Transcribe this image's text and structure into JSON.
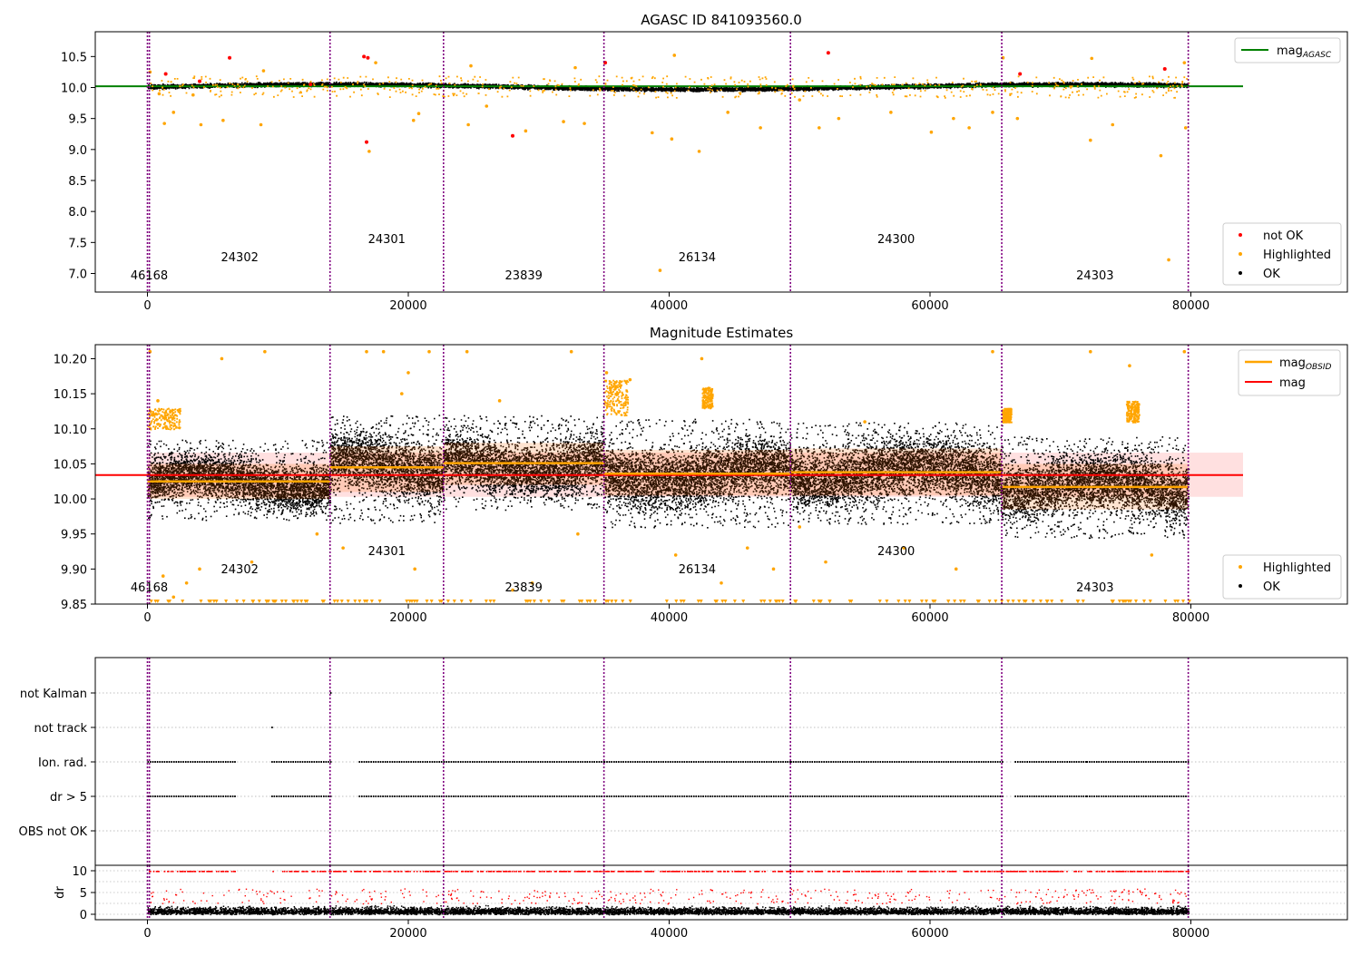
{
  "chart_data": [
    {
      "type": "scatter",
      "title": "AGASC ID 841093560.0",
      "xlabel": "",
      "ylabel": "",
      "xlim": [
        -4000,
        92000
      ],
      "ylim": [
        6.7,
        10.9
      ],
      "xticks": [
        0,
        20000,
        40000,
        60000,
        80000
      ],
      "xtick_labels": [
        "0",
        "20000",
        "40000",
        "60000",
        "80000"
      ],
      "yticks": [
        7.0,
        7.5,
        8.0,
        8.5,
        9.0,
        9.5,
        10.0,
        10.5
      ],
      "ytick_labels": [
        "7.0",
        "7.5",
        "8.0",
        "8.5",
        "9.0",
        "9.5",
        "10.0",
        "10.5"
      ],
      "reference_line": {
        "name": "mag",
        "name_sub": "AGASC",
        "value": 10.02,
        "color": "#008000"
      },
      "legend_top": "top-right",
      "legend_bottom": "bottom-right",
      "series": [
        {
          "name": "not OK",
          "color": "#ff0000",
          "points": [
            [
              1400,
              10.22
            ],
            [
              4000,
              10.1
            ],
            [
              6300,
              10.48
            ],
            [
              16600,
              10.5
            ],
            [
              16900,
              10.48
            ],
            [
              16800,
              9.12
            ],
            [
              28000,
              9.22
            ],
            [
              35100,
              10.4
            ],
            [
              52200,
              10.56
            ],
            [
              66900,
              10.22
            ],
            [
              78000,
              10.3
            ],
            [
              12500,
              10.05
            ]
          ]
        },
        {
          "name": "Highlighted",
          "color": "#ffa500",
          "points": [
            [
              200,
              10.25
            ],
            [
              900,
              9.9
            ],
            [
              1300,
              9.42
            ],
            [
              2000,
              9.6
            ],
            [
              3500,
              9.88
            ],
            [
              4100,
              9.4
            ],
            [
              5800,
              9.47
            ],
            [
              8700,
              9.4
            ],
            [
              8900,
              10.27
            ],
            [
              17000,
              8.97
            ],
            [
              17500,
              10.4
            ],
            [
              20400,
              9.47
            ],
            [
              20800,
              9.58
            ],
            [
              24800,
              10.35
            ],
            [
              24600,
              9.4
            ],
            [
              26000,
              9.7
            ],
            [
              29000,
              9.3
            ],
            [
              31900,
              9.45
            ],
            [
              32800,
              10.32
            ],
            [
              33500,
              9.42
            ],
            [
              38700,
              9.27
            ],
            [
              39300,
              7.05
            ],
            [
              40200,
              9.17
            ],
            [
              40400,
              10.52
            ],
            [
              42300,
              8.97
            ],
            [
              44500,
              9.6
            ],
            [
              47000,
              9.35
            ],
            [
              50000,
              9.8
            ],
            [
              51500,
              9.35
            ],
            [
              53000,
              9.5
            ],
            [
              57000,
              9.6
            ],
            [
              60100,
              9.28
            ],
            [
              61800,
              9.5
            ],
            [
              63000,
              9.35
            ],
            [
              64800,
              9.6
            ],
            [
              65600,
              10.48
            ],
            [
              66700,
              9.5
            ],
            [
              72300,
              9.15
            ],
            [
              72400,
              10.47
            ],
            [
              74000,
              9.4
            ],
            [
              77700,
              8.9
            ],
            [
              78300,
              7.22
            ],
            [
              79500,
              10.4
            ],
            [
              79600,
              9.35
            ]
          ]
        },
        {
          "name": "OK",
          "color": "#000000",
          "summary": "dense band near 10.0-10.1 across x = 0 to 80000"
        }
      ],
      "obsids": [
        {
          "label": "46168",
          "start": 0,
          "end": 150,
          "level": 0
        },
        {
          "label": "24302",
          "start": 150,
          "end": 14000,
          "level": 1
        },
        {
          "label": "24301",
          "start": 14000,
          "end": 22700,
          "level": 2
        },
        {
          "label": "23839",
          "start": 22700,
          "end": 35000,
          "level": 0
        },
        {
          "label": "26134",
          "start": 35000,
          "end": 49300,
          "level": 1
        },
        {
          "label": "24300",
          "start": 49300,
          "end": 65500,
          "level": 2
        },
        {
          "label": "24303",
          "start": 65500,
          "end": 79800,
          "level": 0
        }
      ]
    },
    {
      "type": "scatter",
      "title": "Magnitude Estimates",
      "xlabel": "",
      "ylabel": "",
      "xlim": [
        -4000,
        92000
      ],
      "ylim": [
        9.85,
        10.22
      ],
      "xticks": [
        0,
        20000,
        40000,
        60000,
        80000
      ],
      "xtick_labels": [
        "0",
        "20000",
        "40000",
        "60000",
        "80000"
      ],
      "yticks": [
        9.85,
        9.9,
        9.95,
        10.0,
        10.05,
        10.1,
        10.15,
        10.2
      ],
      "ytick_labels": [
        "9.85",
        "9.90",
        "9.95",
        "10.00",
        "10.05",
        "10.10",
        "10.15",
        "10.20"
      ],
      "mean_line": {
        "name": "mag",
        "value": 10.034,
        "band": [
          10.003,
          10.066
        ],
        "color": "#ff0000"
      },
      "obsid_mean_name": "mag",
      "obsid_mean_name_sub": "OBSID",
      "obsid_mean_color": "#ffa500",
      "obsid_means": [
        {
          "start": 0,
          "end": 14000,
          "mag": 10.025,
          "low": 10.0,
          "high": 10.05,
          "spread_low": 9.97,
          "spread_high": 10.085
        },
        {
          "start": 14000,
          "end": 22700,
          "mag": 10.045,
          "low": 10.01,
          "high": 10.075,
          "spread_low": 9.965,
          "spread_high": 10.12
        },
        {
          "start": 22700,
          "end": 35000,
          "mag": 10.051,
          "low": 10.02,
          "high": 10.08,
          "spread_low": 9.985,
          "spread_high": 10.12
        },
        {
          "start": 35000,
          "end": 49300,
          "mag": 10.036,
          "low": 10.005,
          "high": 10.07,
          "spread_low": 9.96,
          "spread_high": 10.115
        },
        {
          "start": 49300,
          "end": 65500,
          "mag": 10.038,
          "low": 10.005,
          "high": 10.072,
          "spread_low": 9.965,
          "spread_high": 10.11
        },
        {
          "start": 65500,
          "end": 79800,
          "mag": 10.017,
          "low": 9.985,
          "high": 10.05,
          "spread_low": 9.945,
          "spread_high": 10.09
        }
      ],
      "legend": "top-right",
      "legend_bottom": "bottom-right",
      "series": [
        {
          "name": "Highlighted",
          "color": "#ffa500",
          "points": [
            [
              200,
              10.21
            ],
            [
              500,
              10.12
            ],
            [
              800,
              10.14
            ],
            [
              1200,
              9.89
            ],
            [
              2000,
              9.86
            ],
            [
              3000,
              9.88
            ],
            [
              4000,
              9.9
            ],
            [
              5700,
              10.2
            ],
            [
              8000,
              9.91
            ],
            [
              9000,
              10.21
            ],
            [
              13000,
              9.95
            ],
            [
              15000,
              9.93
            ],
            [
              16800,
              10.21
            ],
            [
              18100,
              10.21
            ],
            [
              19500,
              10.15
            ],
            [
              20000,
              10.18
            ],
            [
              20500,
              9.9
            ],
            [
              21600,
              10.21
            ],
            [
              24500,
              10.21
            ],
            [
              27000,
              10.14
            ],
            [
              28000,
              9.87
            ],
            [
              29500,
              9.88
            ],
            [
              32500,
              10.21
            ],
            [
              33000,
              9.95
            ],
            [
              35200,
              10.18
            ],
            [
              36000,
              10.15
            ],
            [
              37000,
              10.17
            ],
            [
              40500,
              9.92
            ],
            [
              42500,
              10.2
            ],
            [
              44000,
              9.88
            ],
            [
              46000,
              9.93
            ],
            [
              48000,
              9.9
            ],
            [
              50000,
              9.96
            ],
            [
              52000,
              9.91
            ],
            [
              55000,
              10.11
            ],
            [
              58000,
              9.93
            ],
            [
              62000,
              9.9
            ],
            [
              64800,
              10.21
            ],
            [
              66000,
              10.12
            ],
            [
              72300,
              10.21
            ],
            [
              75300,
              10.19
            ],
            [
              77000,
              9.92
            ],
            [
              79500,
              10.21
            ]
          ]
        },
        {
          "name": "OK",
          "color": "#000000",
          "summary": "dense scatter around per-OBSID means"
        }
      ],
      "obsids": [
        {
          "label": "46168",
          "start": 0,
          "end": 150,
          "level": 0
        },
        {
          "label": "24302",
          "start": 150,
          "end": 14000,
          "level": 1
        },
        {
          "label": "24301",
          "start": 14000,
          "end": 22700,
          "level": 2
        },
        {
          "label": "23839",
          "start": 22700,
          "end": 35000,
          "level": 0
        },
        {
          "label": "26134",
          "start": 35000,
          "end": 49300,
          "level": 1
        },
        {
          "label": "24300",
          "start": 49300,
          "end": 65500,
          "level": 2
        },
        {
          "label": "24303",
          "start": 65500,
          "end": 79800,
          "level": 0
        }
      ]
    },
    {
      "type": "scatter",
      "title": "",
      "xlim": [
        -4000,
        92000
      ],
      "categories": [
        "not Kalman",
        "not track",
        "Ion. rad.",
        "dr > 5",
        "OBS not OK"
      ],
      "flag_rows": [
        {
          "label": "not Kalman",
          "segments": [
            [
              14000,
              14100
            ]
          ]
        },
        {
          "label": "not track",
          "segments": [
            [
              9500,
              9600
            ]
          ]
        },
        {
          "label": "Ion. rad.",
          "segments": [
            [
              0,
              6700
            ],
            [
              9500,
              14100
            ],
            [
              16200,
              22700
            ],
            [
              22700,
              35000
            ],
            [
              35000,
              49300
            ],
            [
              49300,
              65500
            ],
            [
              66500,
              72000
            ],
            [
              72000,
              79800
            ]
          ]
        },
        {
          "label": "dr > 5",
          "segments": [
            [
              0,
              6700
            ],
            [
              9500,
              14100
            ],
            [
              16200,
              22700
            ],
            [
              22700,
              35000
            ],
            [
              35000,
              49300
            ],
            [
              49300,
              65500
            ],
            [
              66500,
              72000
            ],
            [
              72000,
              79800
            ]
          ]
        },
        {
          "label": "OBS not OK",
          "segments": []
        }
      ]
    },
    {
      "type": "scatter",
      "title": "",
      "ylabel": "dr",
      "xlim": [
        -4000,
        92000
      ],
      "ylim": [
        -0.5,
        10.5
      ],
      "yticks": [
        0,
        5,
        10
      ],
      "ytick_labels": [
        "0",
        "5",
        "10"
      ],
      "xticks": [
        0,
        20000,
        40000,
        60000,
        80000
      ],
      "xtick_labels": [
        "0",
        "20000",
        "40000",
        "60000",
        "80000"
      ],
      "series": [
        {
          "name": "dr",
          "color": "#000000",
          "summary": "dense band 0-3"
        },
        {
          "name": "dr > 5",
          "color": "#ff0000",
          "summary": "capped at 10 where flagged; spikes 3-6 in places"
        }
      ]
    }
  ]
}
